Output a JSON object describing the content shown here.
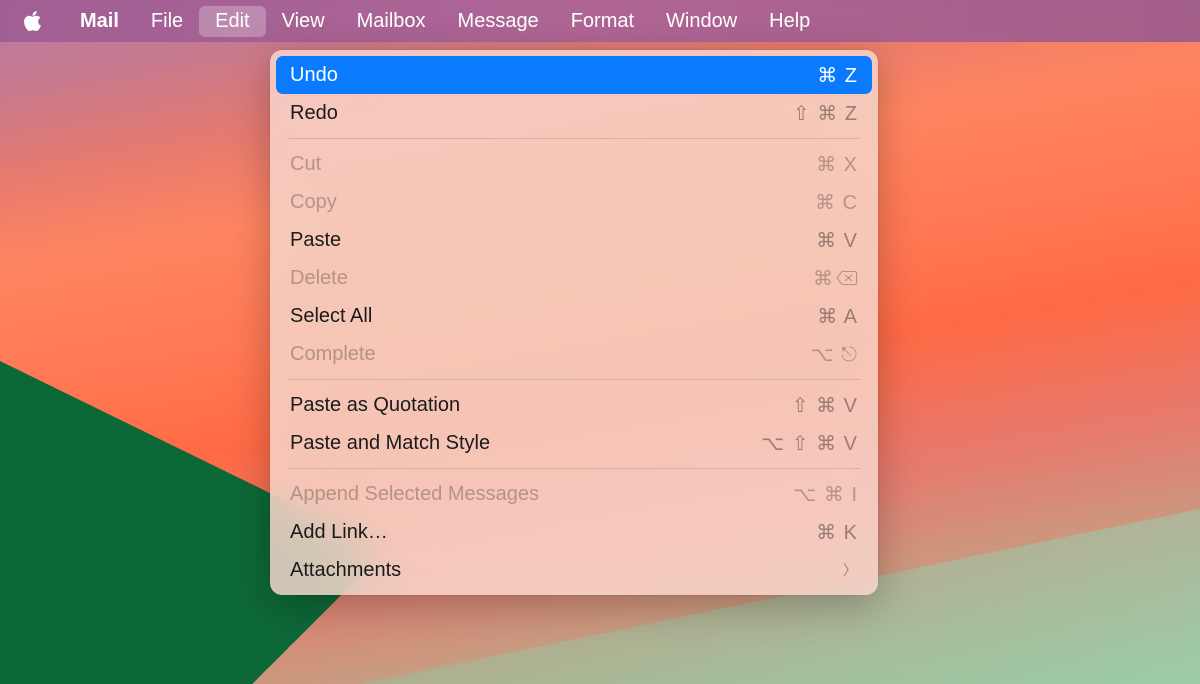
{
  "menubar": {
    "appName": "Mail",
    "items": [
      {
        "label": "File",
        "id": "file"
      },
      {
        "label": "Edit",
        "id": "edit",
        "active": true
      },
      {
        "label": "View",
        "id": "view"
      },
      {
        "label": "Mailbox",
        "id": "mailbox"
      },
      {
        "label": "Message",
        "id": "message"
      },
      {
        "label": "Format",
        "id": "format"
      },
      {
        "label": "Window",
        "id": "window"
      },
      {
        "label": "Help",
        "id": "help"
      }
    ]
  },
  "editMenu": {
    "groups": [
      [
        {
          "label": "Undo",
          "shortcut": "⌘ Z",
          "highlighted": true,
          "disabled": false,
          "id": "undo"
        },
        {
          "label": "Redo",
          "shortcut": "⇧ ⌘ Z",
          "highlighted": false,
          "disabled": false,
          "id": "redo"
        }
      ],
      [
        {
          "label": "Cut",
          "shortcut": "⌘ X",
          "highlighted": false,
          "disabled": true,
          "id": "cut"
        },
        {
          "label": "Copy",
          "shortcut": "⌘ C",
          "highlighted": false,
          "disabled": true,
          "id": "copy"
        },
        {
          "label": "Paste",
          "shortcut": "⌘ V",
          "highlighted": false,
          "disabled": false,
          "id": "paste"
        },
        {
          "label": "Delete",
          "shortcut": "⌘ ⌫",
          "highlighted": false,
          "disabled": true,
          "id": "delete",
          "deleteIcon": true
        },
        {
          "label": "Select All",
          "shortcut": "⌘ A",
          "highlighted": false,
          "disabled": false,
          "id": "select-all"
        },
        {
          "label": "Complete",
          "shortcut": "⌥ ⎋",
          "highlighted": false,
          "disabled": true,
          "id": "complete"
        }
      ],
      [
        {
          "label": "Paste as Quotation",
          "shortcut": "⇧ ⌘ V",
          "highlighted": false,
          "disabled": false,
          "id": "paste-quotation"
        },
        {
          "label": "Paste and Match Style",
          "shortcut": "⌥ ⇧ ⌘ V",
          "highlighted": false,
          "disabled": false,
          "id": "paste-match-style"
        }
      ],
      [
        {
          "label": "Append Selected Messages",
          "shortcut": "⌥ ⌘ I",
          "highlighted": false,
          "disabled": true,
          "id": "append-selected"
        },
        {
          "label": "Add Link…",
          "shortcut": "⌘ K",
          "highlighted": false,
          "disabled": false,
          "id": "add-link"
        },
        {
          "label": "Attachments",
          "shortcut": "",
          "highlighted": false,
          "disabled": false,
          "id": "attachments",
          "submenu": true
        }
      ]
    ]
  }
}
